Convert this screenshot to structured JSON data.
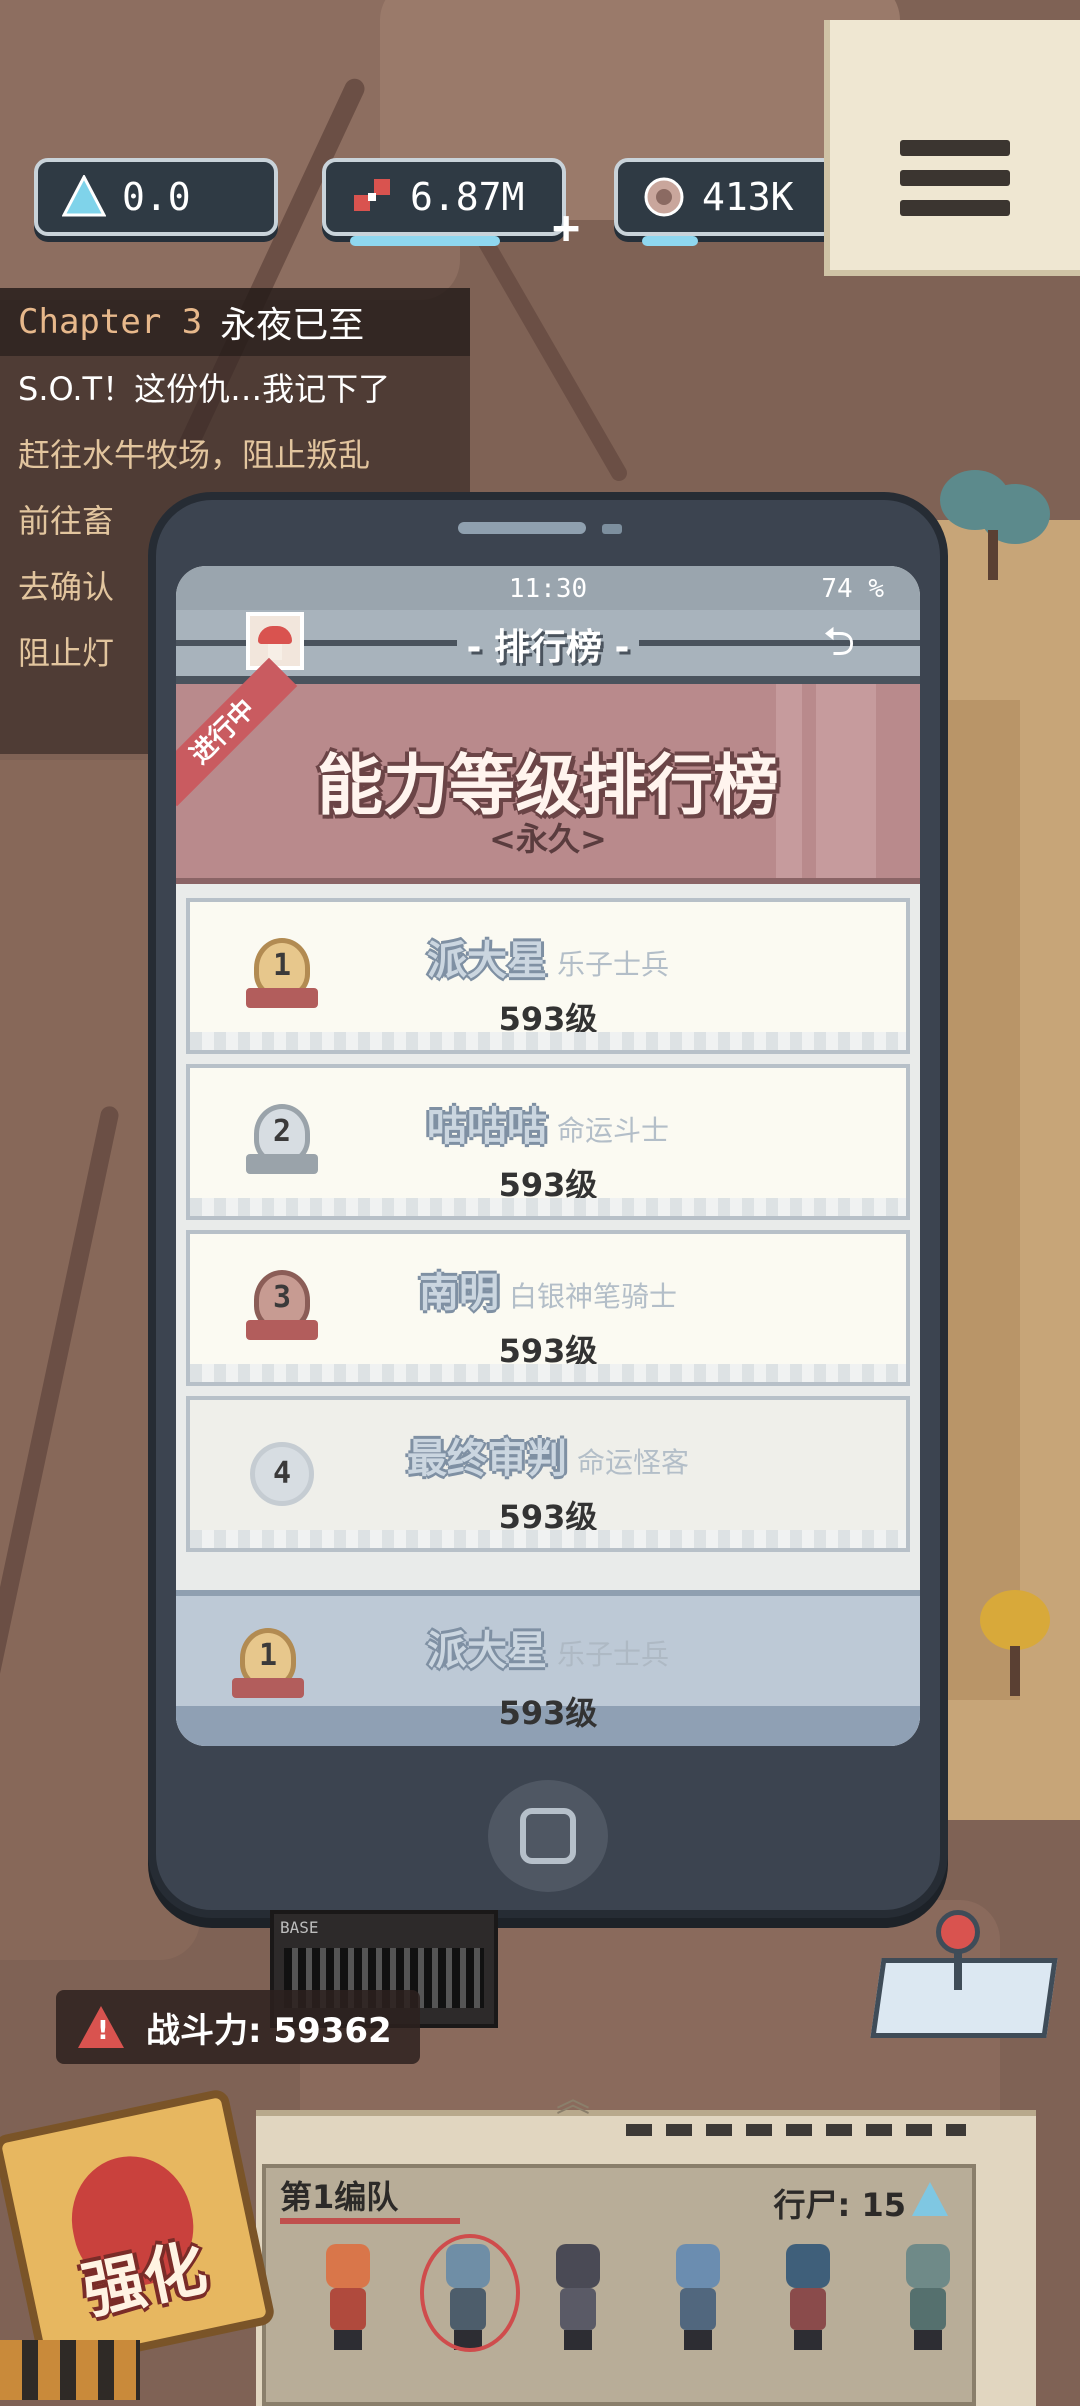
{
  "hud": {
    "crystal_value": "0.0",
    "resource_value": "6.87M",
    "coin_value": "413K",
    "resource_bar": 0.8,
    "coin_bar": 0.3
  },
  "quest": {
    "chapter": "Chapter 3",
    "chapter_name": "永夜已至",
    "items": [
      "S.O.T！这份仇…我记下了",
      "赶往水牛牧场，阻止叛乱",
      "前往畜",
      "去确认",
      "阻止灯"
    ]
  },
  "phone": {
    "time": "11:30",
    "battery": "74 %",
    "title": "- 排行榜 -",
    "back_glyph": "⮌",
    "banner_tag": "进行中",
    "banner_title": "能力等级排行榜",
    "banner_sub": "<永久>",
    "ranks": [
      {
        "rank": "1",
        "name": "派大星",
        "class": "乐子士兵",
        "level": "593级"
      },
      {
        "rank": "2",
        "name": "咕咕咕",
        "class": "命运斗士",
        "level": "593级"
      },
      {
        "rank": "3",
        "name": "南明",
        "class": "白银神笔骑士",
        "level": "593级"
      },
      {
        "rank": "4",
        "name": "最终审判",
        "class": "命运怪客",
        "level": "593级"
      }
    ],
    "self": {
      "rank": "1",
      "name": "派大星",
      "class": "乐子士兵",
      "level": "593级"
    }
  },
  "power": {
    "label": "战斗力: 59362",
    "warn": "!"
  },
  "base_sign": "BASE",
  "team": {
    "name": "第1编队",
    "count": "行尸: 15",
    "up_glyph": "︽"
  },
  "boost": {
    "label": "强化"
  },
  "colors": {
    "accent_red": "#d9534f",
    "rock": "#8d6e60",
    "phone_body": "#3c4450",
    "banner": "#b98a8c"
  }
}
